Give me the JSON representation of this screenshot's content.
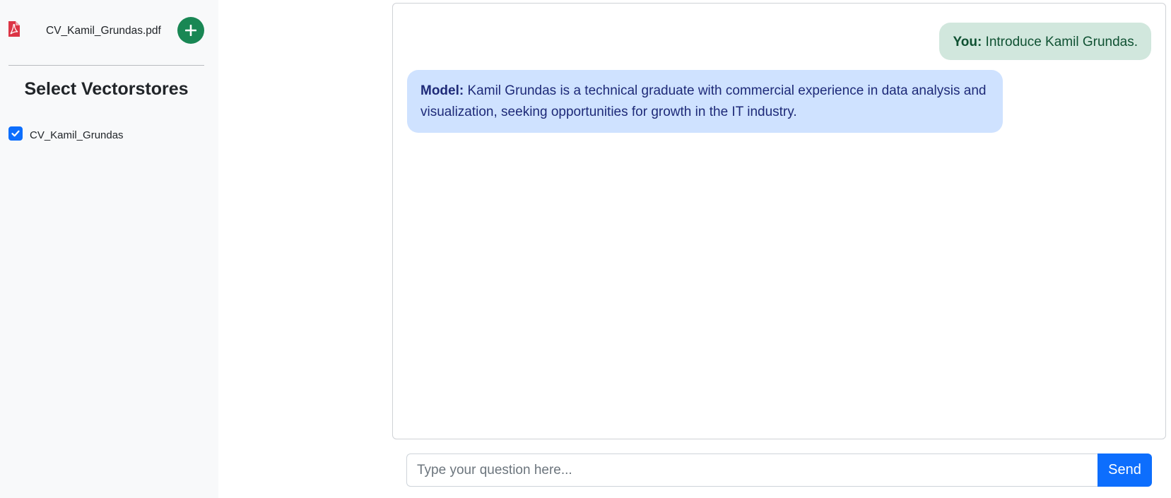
{
  "sidebar": {
    "file": {
      "name": "CV_Kamil_Grundas.pdf",
      "icon": "file-pdf-icon"
    },
    "add_button_icon": "plus-icon",
    "vectorstores_title": "Select Vectorstores",
    "vectorstores": [
      {
        "label": "CV_Kamil_Grundas",
        "checked": true
      }
    ]
  },
  "chat": {
    "messages": [
      {
        "role_label": "You:",
        "text": " Introduce Kamil Grundas."
      },
      {
        "role_label": "Model:",
        "text": " Kamil Grundas is a technical graduate with commercial experience in data analysis and visualization, seeking opportunities for growth in the IT industry."
      }
    ]
  },
  "input": {
    "placeholder": "Type your question here...",
    "value": "",
    "send_label": "Send"
  },
  "colors": {
    "sidebar_bg": "#f8f9fa",
    "add_button": "#198754",
    "checkbox": "#0d6efd",
    "user_bubble": "#d1e7dd",
    "model_bubble": "#cfe2ff",
    "send_button": "#0d6efd",
    "pdf_icon": "#dc3545"
  }
}
